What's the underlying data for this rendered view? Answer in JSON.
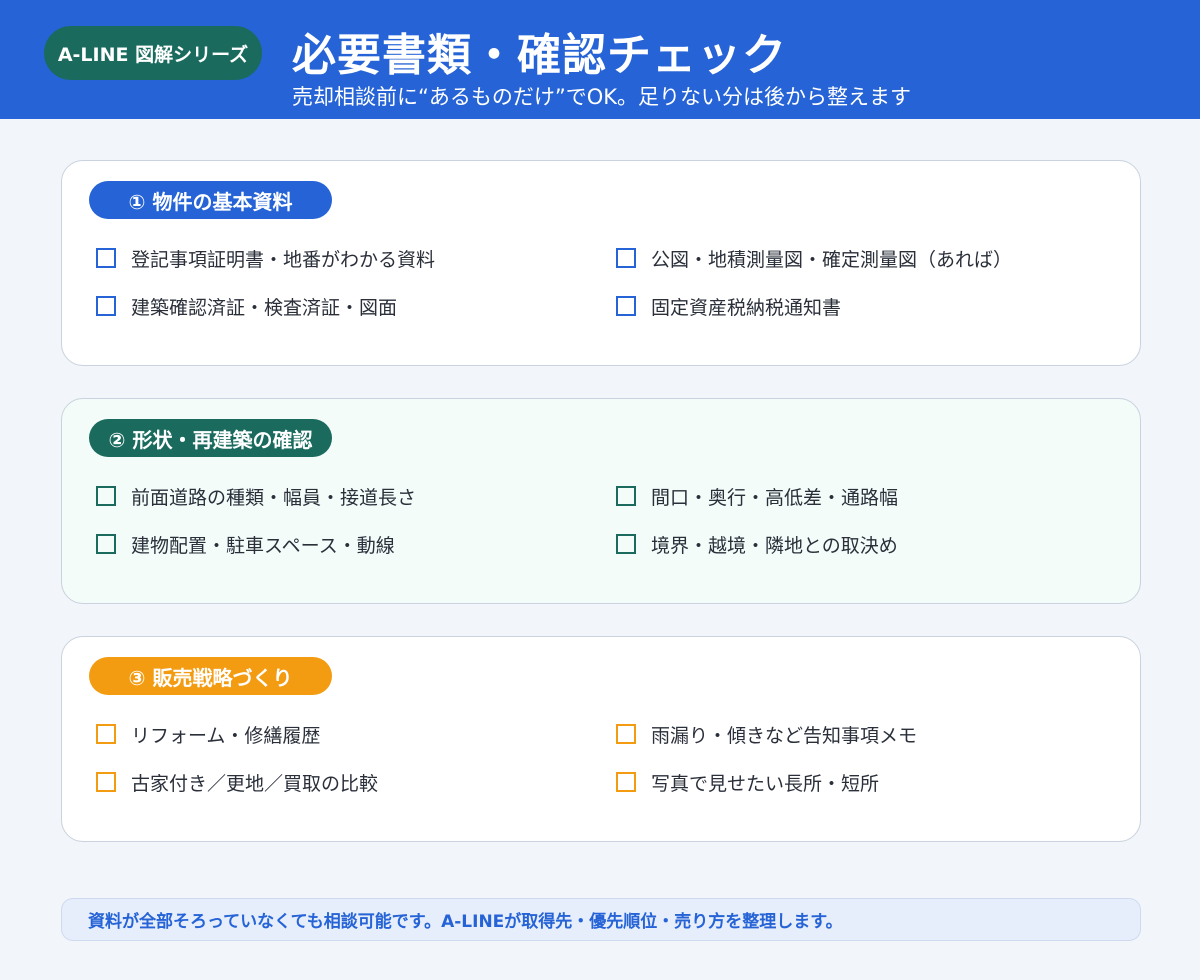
{
  "header": {
    "brand": "A-LINE 図解シリーズ",
    "title": "必要書類・確認チェック",
    "subtitle": "売却相談前に“あるものだけ”でOK。足りない分は後から整えます",
    "bg_color": "#2563d6",
    "brand_color": "#1a6b5e"
  },
  "sections": [
    {
      "badge": "① 物件の基本資料",
      "accent": "#2563d6",
      "items": [
        "登記事項証明書・地番がわかる資料",
        "公図・地積測量図・確定測量図（あれば）",
        "建築確認済証・検査済証・図面",
        "固定資産税納税通知書"
      ]
    },
    {
      "badge": "② 形状・再建築の確認",
      "accent": "#1a6b5e",
      "items": [
        "前面道路の種類・幅員・接道長さ",
        "間口・奥行・高低差・通路幅",
        "建物配置・駐車スペース・動線",
        "境界・越境・隣地との取決め"
      ]
    },
    {
      "badge": "③ 販売戦略づくり",
      "accent": "#f39c12",
      "items": [
        "リフォーム・修繕履歴",
        "雨漏り・傾きなど告知事項メモ",
        "古家付き／更地／買取の比較",
        "写真で見せたい長所・短所"
      ]
    }
  ],
  "footer": {
    "text": "資料が全部そろっていなくても相談可能です。A-LINEが取得先・優先順位・売り方を整理します。"
  }
}
